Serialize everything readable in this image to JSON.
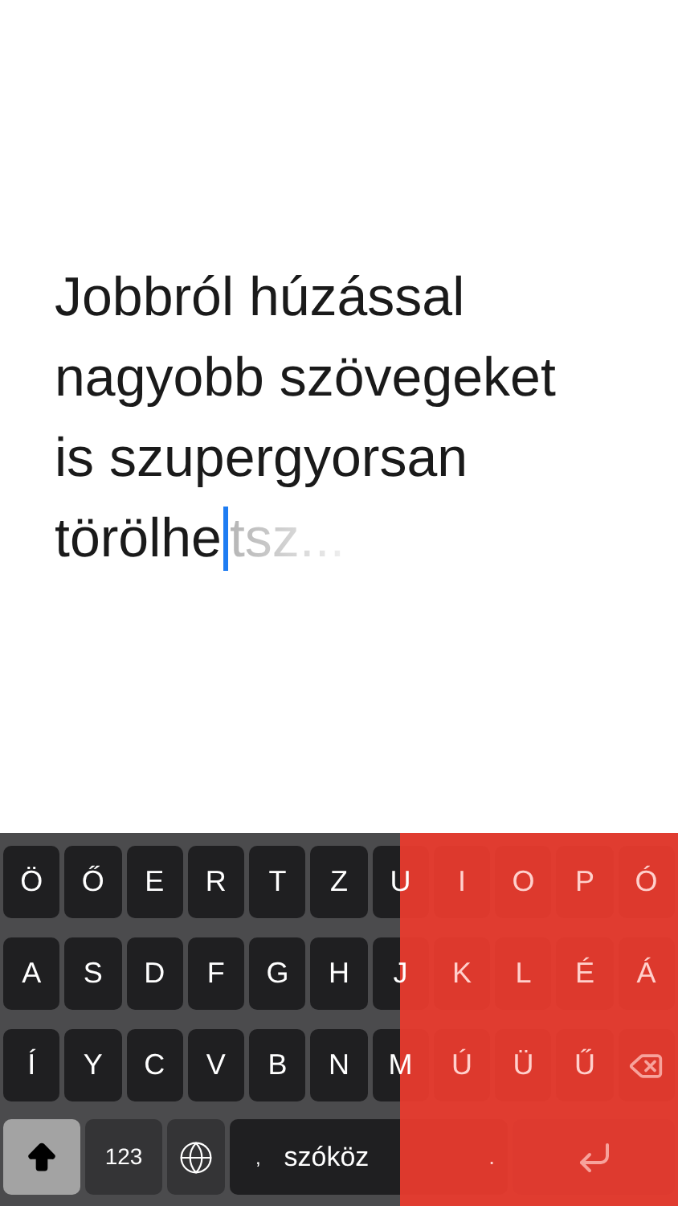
{
  "text": {
    "lines": [
      "Jobbról húzással",
      "nagyobb szövegeket",
      "is szupergyorsan",
      "törölhe"
    ],
    "ghost_text": "tsz..."
  },
  "keyboard": {
    "rows": [
      [
        {
          "kind": "letter",
          "label": "Ö"
        },
        {
          "kind": "letter",
          "label": "Ő"
        },
        {
          "kind": "letter",
          "label": "E"
        },
        {
          "kind": "letter",
          "label": "R"
        },
        {
          "kind": "letter",
          "label": "T"
        },
        {
          "kind": "letter",
          "label": "Z"
        },
        {
          "kind": "letter",
          "label": "U"
        },
        {
          "kind": "letter",
          "label": "I",
          "covered": true
        },
        {
          "kind": "letter",
          "label": "O",
          "covered": true
        },
        {
          "kind": "letter",
          "label": "P",
          "covered": true
        },
        {
          "kind": "letter",
          "label": "Ó",
          "covered": true
        }
      ],
      [
        {
          "kind": "letter",
          "label": "A"
        },
        {
          "kind": "letter",
          "label": "S"
        },
        {
          "kind": "letter",
          "label": "D"
        },
        {
          "kind": "letter",
          "label": "F"
        },
        {
          "kind": "letter",
          "label": "G"
        },
        {
          "kind": "letter",
          "label": "H"
        },
        {
          "kind": "letter",
          "label": "J"
        },
        {
          "kind": "letter",
          "label": "K",
          "covered": true
        },
        {
          "kind": "letter",
          "label": "L",
          "covered": true
        },
        {
          "kind": "letter",
          "label": "É",
          "covered": true
        },
        {
          "kind": "letter",
          "label": "Á",
          "covered": true
        }
      ],
      [
        {
          "kind": "letter",
          "label": "Í"
        },
        {
          "kind": "letter",
          "label": "Y"
        },
        {
          "kind": "letter",
          "label": "C"
        },
        {
          "kind": "letter",
          "label": "V"
        },
        {
          "kind": "letter",
          "label": "B"
        },
        {
          "kind": "letter",
          "label": "N"
        },
        {
          "kind": "letter",
          "label": "M"
        },
        {
          "kind": "letter",
          "label": "Ú",
          "covered": true
        },
        {
          "kind": "letter",
          "label": "Ü",
          "covered": true
        },
        {
          "kind": "letter",
          "label": "Ű",
          "covered": true
        },
        {
          "kind": "backspace"
        }
      ]
    ],
    "bottom_row": {
      "shift_on": true,
      "numbers_label": "123",
      "space_labels": [
        ",",
        "szóköz",
        "."
      ]
    }
  }
}
